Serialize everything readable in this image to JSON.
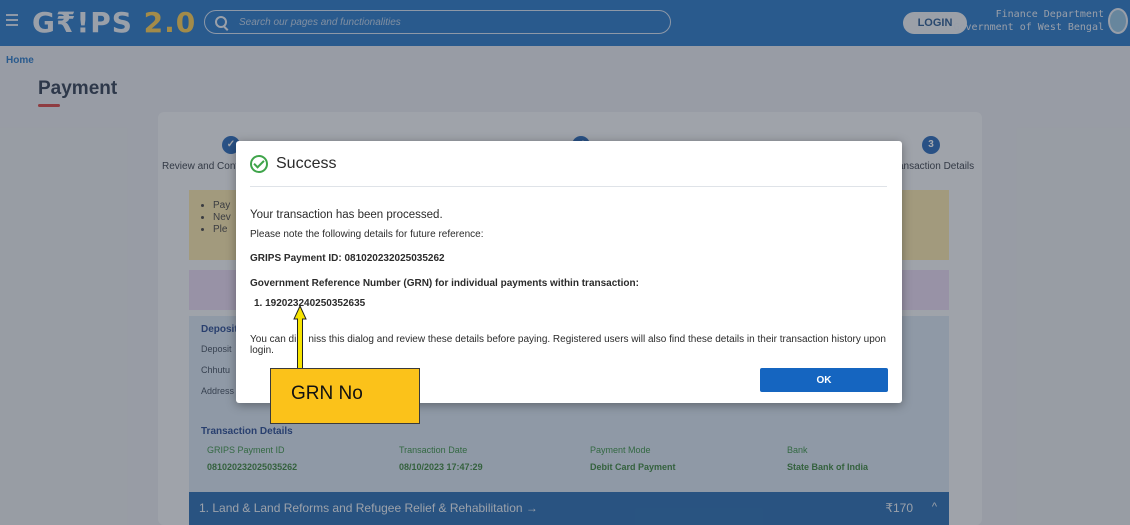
{
  "header": {
    "logo_text": "G₹!PS",
    "logo_version": "2.0",
    "search_placeholder": "Search our pages and functionalities",
    "login_label": "LOGIN",
    "dept_line1": "Finance Department",
    "dept_line2": "Government of West Bengal"
  },
  "breadcrumb": {
    "home": "Home"
  },
  "page": {
    "title": "Payment"
  },
  "stepper": {
    "step1_label": "Review and Confi",
    "step3_number": "3",
    "step3_label": "ansaction Details"
  },
  "notice": {
    "items": [
      "Pay",
      "Nev",
      "Ple"
    ]
  },
  "depositor": {
    "heading": "Deposito",
    "rows": [
      "Deposit",
      "Chhutu",
      "Address"
    ]
  },
  "transaction_details": {
    "heading": "Transaction Details",
    "columns": [
      "GRIPS Payment ID",
      "Transaction Date",
      "Payment Mode",
      "Bank"
    ],
    "values": [
      "081020232025035262",
      "08/10/2023 17:47:29",
      "Debit Card Payment",
      "State Bank of India"
    ]
  },
  "accordion": {
    "title": "1. Land & Land Reforms and Refugee Relief & Rehabilitation →",
    "amount": "₹170",
    "chevron": "^"
  },
  "dialog": {
    "title": "Success",
    "line1": "Your transaction has been processed.",
    "line2": "Please note the following details for future reference:",
    "payment_id_line": "GRIPS Payment ID: 081020232025035262",
    "grn_heading": "Government Reference Number (GRN) for individual payments within transaction:",
    "grn_item": "1. 192023240250352635",
    "note_start": "You can di",
    "note_end": "niss this dialog and review these details before paying. Registered users will also find these details in their transaction history upon login.",
    "ok_label": "OK"
  },
  "annotation": {
    "label": "GRN No",
    "color": "#fbc21a"
  },
  "colors": {
    "header_blue": "#1a6fc4",
    "accent_red": "#d33a3a",
    "success_green": "#3fa44a",
    "primary_button": "#1565c0"
  }
}
